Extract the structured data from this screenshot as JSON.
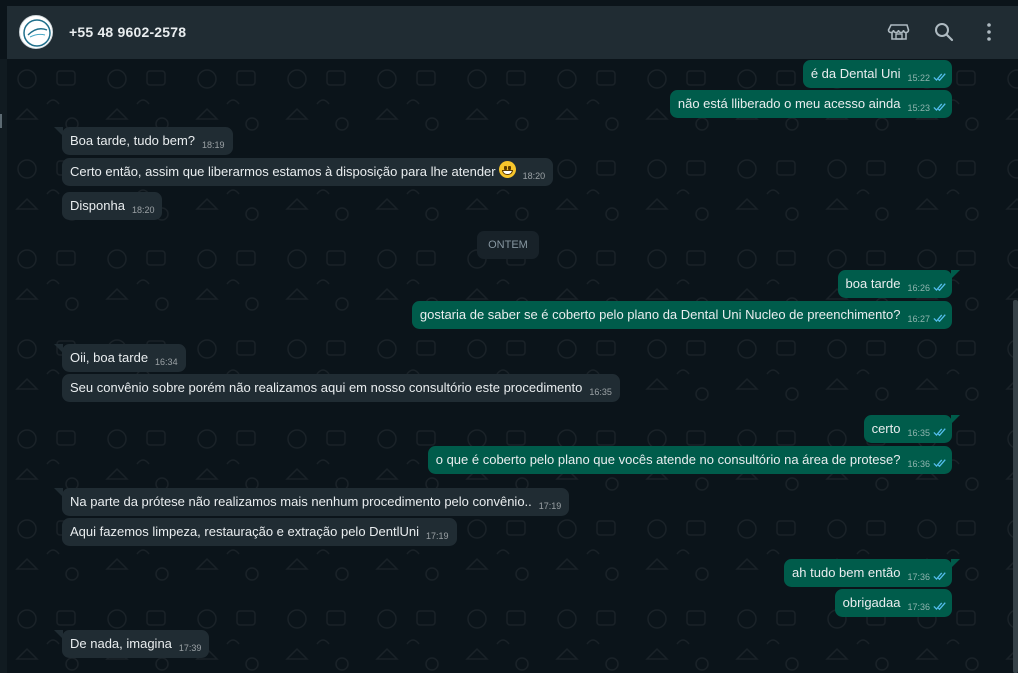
{
  "header": {
    "contact_name": "+55 48 9602-2578",
    "icons": [
      "store-icon",
      "search-icon",
      "menu-icon"
    ]
  },
  "colors": {
    "header_bg": "#202c33",
    "chat_bg": "#0b141a",
    "incoming_bubble": "#202c33",
    "outgoing_bubble": "#005c4b",
    "read_ticks": "#53bdeb"
  },
  "date_separator": "ONTEM",
  "messages": [
    {
      "dir": "out",
      "text": "é da Dental Uni",
      "time": "15:22"
    },
    {
      "dir": "out",
      "text": "não está lliberado o meu acesso ainda",
      "time": "15:23"
    },
    {
      "dir": "in",
      "text": "Boa tarde, tudo bem?",
      "time": "18:19"
    },
    {
      "dir": "in",
      "text": "Certo então, assim que liberarmos estamos à disposição para lhe atender",
      "time": "18:20",
      "emoji": "grinning-face"
    },
    {
      "dir": "in",
      "text": "Disponha",
      "time": "18:20"
    },
    {
      "dir": "out",
      "text": "boa tarde",
      "time": "16:26"
    },
    {
      "dir": "out",
      "text": "gostaria de saber se é coberto pelo plano da Dental Uni Nucleo de preenchimento?",
      "time": "16:27"
    },
    {
      "dir": "in",
      "text": "Oii, boa tarde",
      "time": "16:34"
    },
    {
      "dir": "in",
      "text": "Seu convênio sobre porém não realizamos aqui em  nosso consultório este procedimento",
      "time": "16:35"
    },
    {
      "dir": "out",
      "text": "certo",
      "time": "16:35"
    },
    {
      "dir": "out",
      "text": "o que é coberto pelo plano que vocês atende no consultório na área de protese?",
      "time": "16:36"
    },
    {
      "dir": "in",
      "text": "Na parte da prótese não realizamos mais nenhum procedimento pelo convênio..",
      "time": "17:19"
    },
    {
      "dir": "in",
      "text": "Aqui fazemos limpeza, restauração e extração pelo DentlUni",
      "time": "17:19"
    },
    {
      "dir": "out",
      "text": "ah tudo bem então",
      "time": "17:36"
    },
    {
      "dir": "out",
      "text": "obrigadaa",
      "time": "17:36"
    },
    {
      "dir": "in",
      "text": "De nada, imagina",
      "time": "17:39"
    }
  ]
}
